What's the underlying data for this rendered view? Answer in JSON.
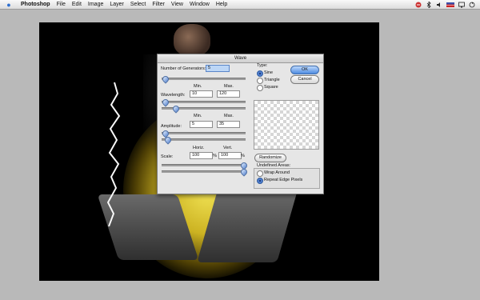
{
  "menubar": {
    "apple_icon": "apple-icon",
    "app_name": "Photoshop",
    "items": [
      "File",
      "Edit",
      "Image",
      "Layer",
      "Select",
      "Filter",
      "View",
      "Window",
      "Help"
    ],
    "status_icons": [
      "script-icon",
      "bluetooth-icon",
      "volume-icon",
      "us-flag-icon",
      "display-icon",
      "sync-icon"
    ]
  },
  "dialog": {
    "title": "Wave",
    "generators": {
      "label": "Number of Generators:",
      "value": "5"
    },
    "wavelength": {
      "label": "Wavelength:",
      "min_header": "Min.",
      "max_header": "Max.",
      "min": "10",
      "max": "120"
    },
    "amplitude": {
      "label": "Amplitude:",
      "min_header": "Min.",
      "max_header": "Max.",
      "min": "5",
      "max": "35"
    },
    "scale": {
      "label": "Scale:",
      "horiz_header": "Horiz.",
      "vert_header": "Vert.",
      "horiz": "100",
      "vert": "100",
      "unit": "%"
    },
    "type": {
      "label": "Type:",
      "options": [
        "Sine",
        "Triangle",
        "Square"
      ],
      "selected": "Sine"
    },
    "ok_label": "OK",
    "cancel_label": "Cancel",
    "randomize_label": "Randomize",
    "undefined_areas": {
      "label": "Undefined Areas:",
      "options": [
        "Wrap Around",
        "Repeat Edge Pixels"
      ],
      "selected": "Repeat Edge Pixels"
    }
  },
  "colors": {
    "accent": "#4f8ce0",
    "canvas_bg": "#000000",
    "glow": "#f0d228"
  }
}
